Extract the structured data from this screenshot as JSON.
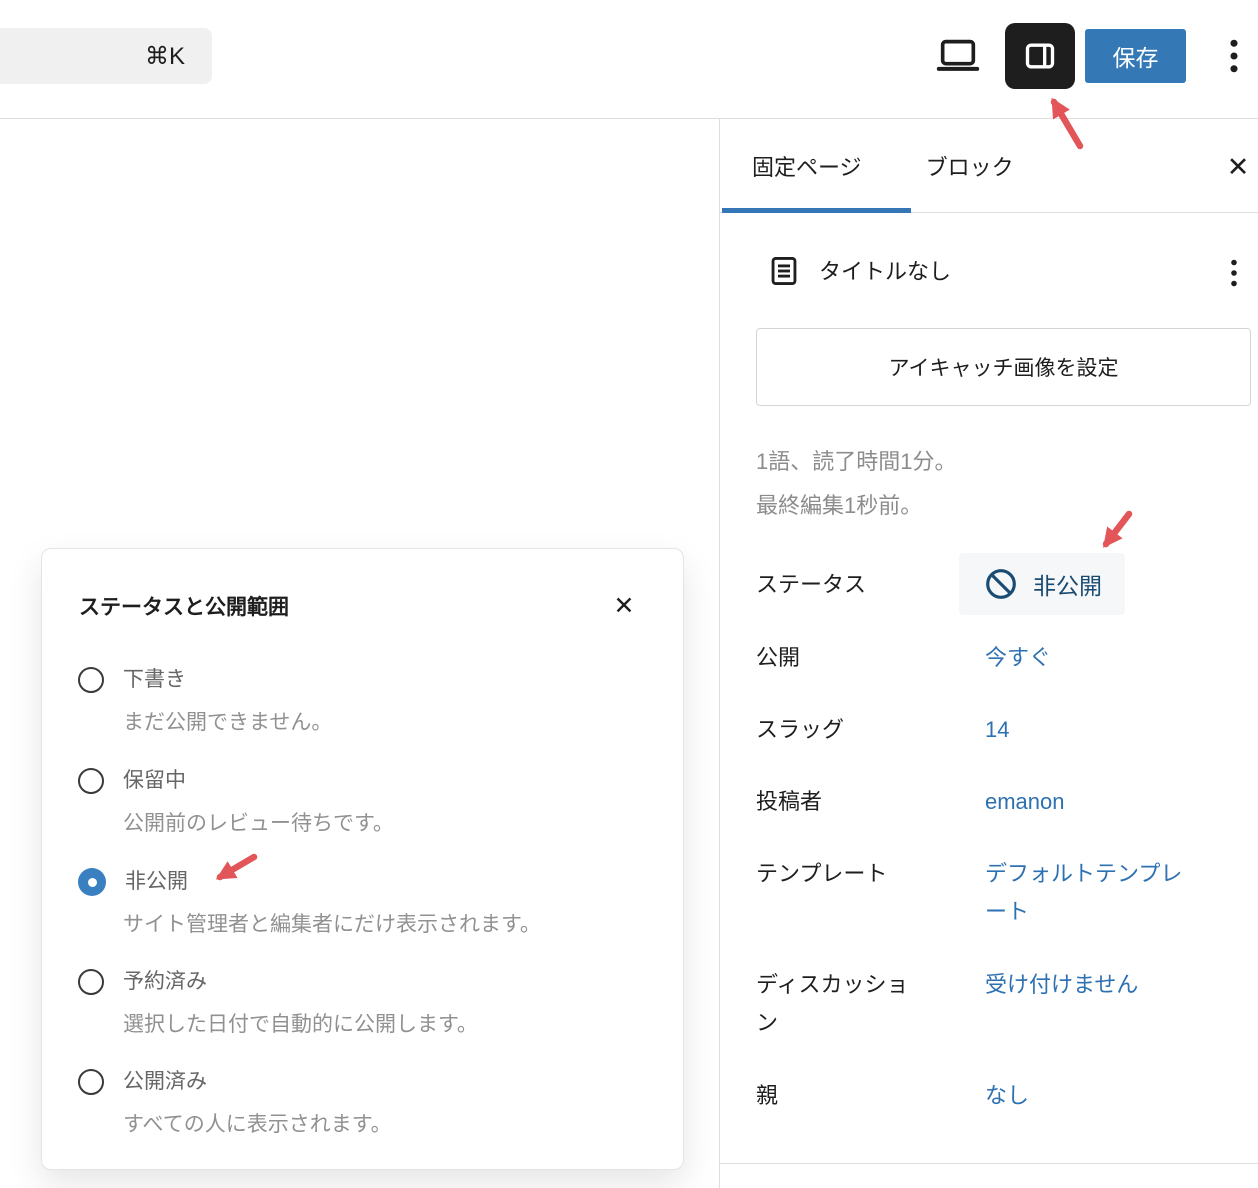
{
  "header": {
    "shortcut_hint": "⌘K",
    "save_label": "保存"
  },
  "sidebar": {
    "tabs": [
      {
        "label": "固定ページ",
        "active": true
      },
      {
        "label": "ブロック",
        "active": false
      }
    ],
    "card": {
      "title": "タイトルなし"
    },
    "featured_button_label": "アイキャッチ画像を設定",
    "meta": {
      "word_count": "1語、読了時間1分。",
      "last_edited": "最終編集1秒前。"
    },
    "rows": [
      {
        "label": "ステータス",
        "value": "非公開"
      },
      {
        "label": "公開",
        "value": "今すぐ"
      },
      {
        "label": "スラッグ",
        "value": "14"
      },
      {
        "label": "投稿者",
        "value": "emanon"
      },
      {
        "label": "テンプレート",
        "value": "デフォルトテンプレート"
      },
      {
        "label": "ディスカッション",
        "value": "受け付けません"
      },
      {
        "label": "親",
        "value": "なし"
      }
    ]
  },
  "dialog": {
    "title": "ステータスと公開範囲",
    "options": [
      {
        "label": "下書き",
        "description": "まだ公開できません。",
        "selected": false
      },
      {
        "label": "保留中",
        "description": "公開前のレビュー待ちです。",
        "selected": false
      },
      {
        "label": "非公開",
        "description": "サイト管理者と編集者にだけ表示されます。",
        "selected": true
      },
      {
        "label": "予約済み",
        "description": "選択した日付で自動的に公開します。",
        "selected": false
      },
      {
        "label": "公開済み",
        "description": "すべての人に表示されます。",
        "selected": false
      }
    ]
  },
  "icons": {
    "close": "✕",
    "more": "vertical three dots",
    "preview": "laptop outline",
    "sidebar_toggle": "panel with right column",
    "page": "document with lines",
    "status_private": "prohibition circle"
  },
  "colors": {
    "accent_blue": "#3577b6",
    "link_blue": "#2e71b2",
    "chip_text_blue": "#1a4b72",
    "chip_bg": "#f5f7f9",
    "save_button_blue": "#3479b6",
    "toggle_button_bg": "#1e1e1e",
    "annotation_red": "#e25558",
    "border_gray": "#dedede",
    "text_dark": "#1e1e1e",
    "text_gray": "#8c8c8c",
    "option_label_gray": "#666666",
    "option_desc_gray": "#919191"
  }
}
